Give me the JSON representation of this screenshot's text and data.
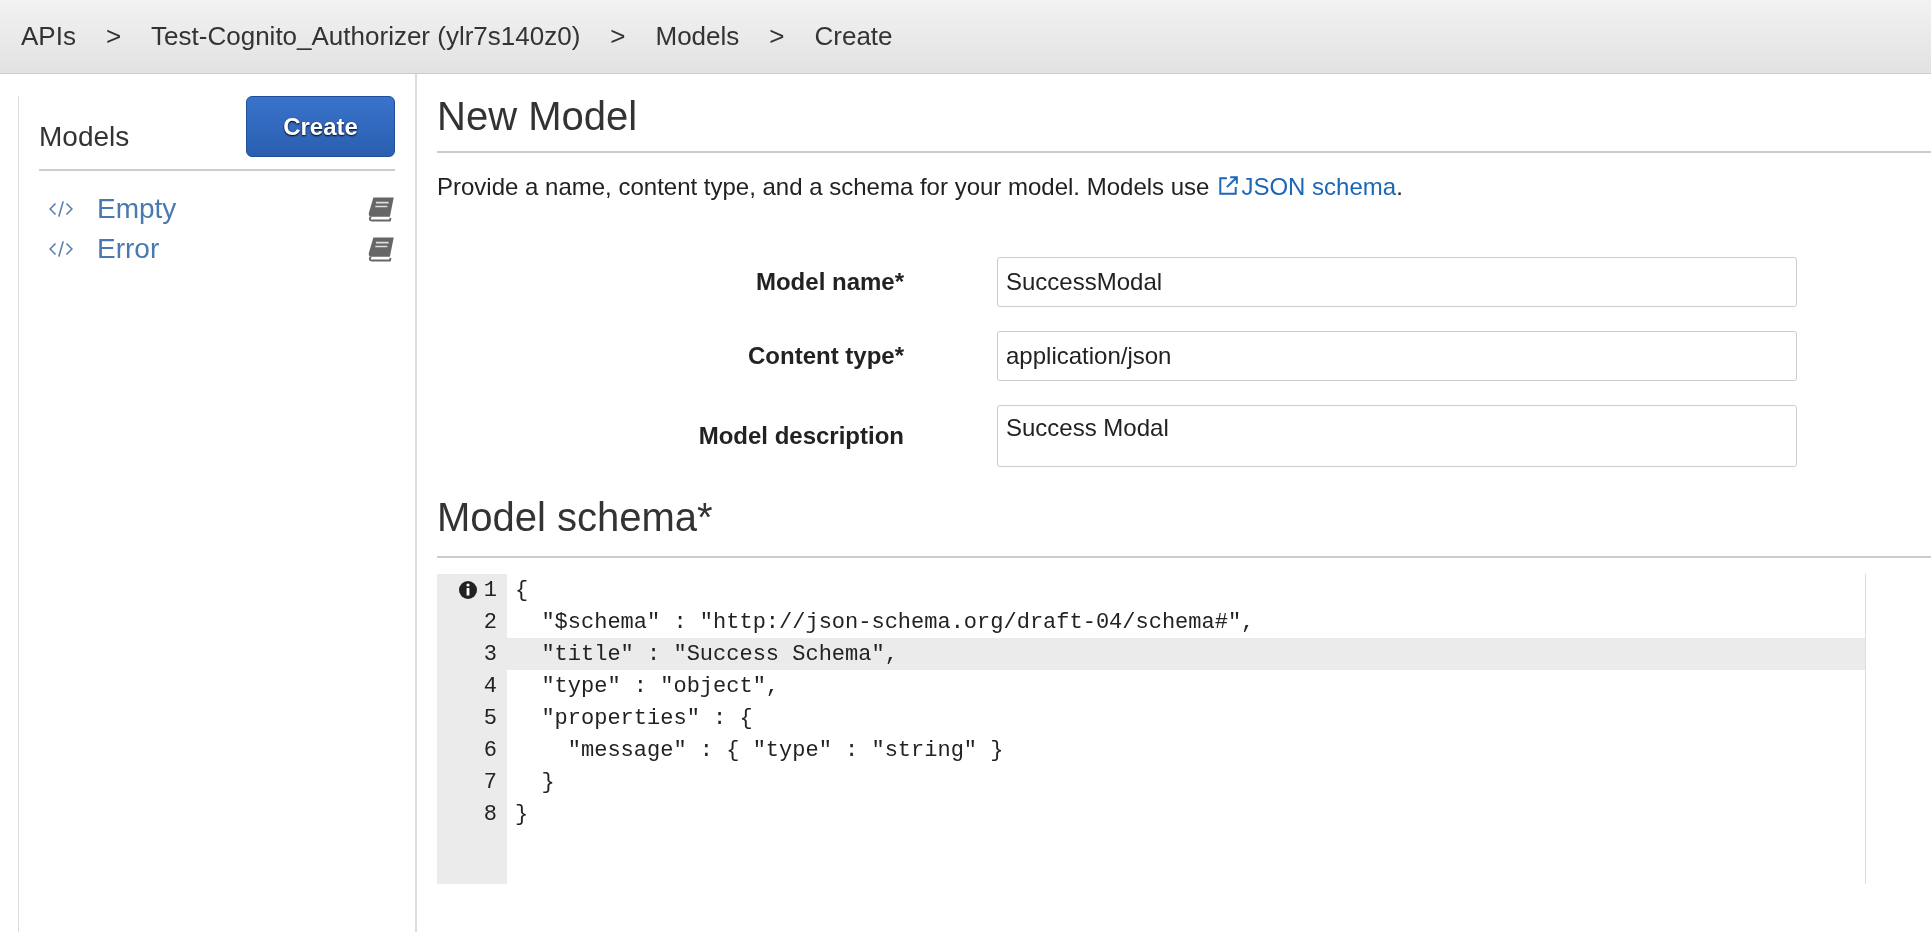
{
  "breadcrumb": [
    {
      "label": "APIs"
    },
    {
      "label": "Test-Cognito_Authorizer (ylr7s140z0)"
    },
    {
      "label": "Models"
    },
    {
      "label": "Create"
    }
  ],
  "breadcrumb_separator": ">",
  "sidebar": {
    "title": "Models",
    "create_button": "Create",
    "items": [
      {
        "label": "Empty"
      },
      {
        "label": "Error"
      }
    ]
  },
  "main": {
    "title": "New Model",
    "intro": "Provide a name, content type, and a schema for your model. Models use",
    "intro_link": "JSON schema",
    "intro_end": ".",
    "fields": [
      {
        "label": "Model name*",
        "value": "SuccessModal",
        "kind": "input"
      },
      {
        "label": "Content type*",
        "value": "application/json",
        "kind": "input"
      },
      {
        "label": "Model description",
        "value": "Success Modal",
        "kind": "textarea"
      }
    ],
    "schema_title": "Model schema*",
    "editor": {
      "lines": [
        {
          "number": "1",
          "code": "{",
          "active": false,
          "info": true
        },
        {
          "number": "2",
          "code": "  \"$schema\" : \"http://json-schema.org/draft-04/schema#\",",
          "active": false,
          "info": false
        },
        {
          "number": "3",
          "code": "  \"title\" : \"Success Schema\",",
          "active": true,
          "info": false
        },
        {
          "number": "4",
          "code": "  \"type\" : \"object\",",
          "active": false,
          "info": false
        },
        {
          "number": "5",
          "code": "  \"properties\" : {",
          "active": false,
          "info": false
        },
        {
          "number": "6",
          "code": "    \"message\" : { \"type\" : \"string\" }",
          "active": false,
          "info": false
        },
        {
          "number": "7",
          "code": "  }",
          "active": false,
          "info": false
        },
        {
          "number": "8",
          "code": "}",
          "active": false,
          "info": false
        }
      ]
    }
  }
}
